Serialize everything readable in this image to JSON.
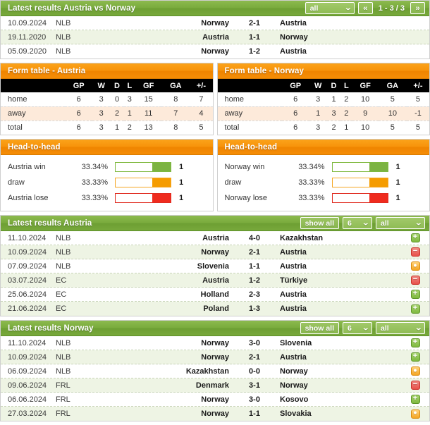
{
  "h2h_results_panel": {
    "title": "Latest results Austria vs Norway",
    "filter_select": "all",
    "pagination": {
      "prev": "«",
      "label": "1 - 3 / 3",
      "next": "»"
    },
    "rows": [
      {
        "date": "10.09.2024",
        "competition": "NLB",
        "home": "Norway",
        "score": "2-1",
        "away": "Austria"
      },
      {
        "date": "19.11.2020",
        "competition": "NLB",
        "home": "Austria",
        "score": "1-1",
        "away": "Norway"
      },
      {
        "date": "05.09.2020",
        "competition": "NLB",
        "home": "Norway",
        "score": "1-2",
        "away": "Austria"
      }
    ]
  },
  "form_table_austria": {
    "title": "Form table - Austria",
    "columns": [
      "",
      "GP",
      "W",
      "D",
      "L",
      "GF",
      "GA",
      "+/-"
    ],
    "rows": [
      {
        "label": "home",
        "gp": "6",
        "w": "3",
        "d": "0",
        "l": "3",
        "gf": "15",
        "ga": "8",
        "diff": "7"
      },
      {
        "label": "away",
        "gp": "6",
        "w": "3",
        "d": "2",
        "l": "1",
        "gf": "11",
        "ga": "7",
        "diff": "4"
      },
      {
        "label": "total",
        "gp": "6",
        "w": "3",
        "d": "1",
        "l": "2",
        "gf": "13",
        "ga": "8",
        "diff": "5"
      }
    ]
  },
  "form_table_norway": {
    "title": "Form table - Norway",
    "columns": [
      "",
      "GP",
      "W",
      "D",
      "L",
      "GF",
      "GA",
      "+/-"
    ],
    "rows": [
      {
        "label": "home",
        "gp": "6",
        "w": "3",
        "d": "1",
        "l": "2",
        "gf": "10",
        "ga": "5",
        "diff": "5"
      },
      {
        "label": "away",
        "gp": "6",
        "w": "1",
        "d": "3",
        "l": "2",
        "gf": "9",
        "ga": "10",
        "diff": "-1"
      },
      {
        "label": "total",
        "gp": "6",
        "w": "3",
        "d": "2",
        "l": "1",
        "gf": "10",
        "ga": "5",
        "diff": "5"
      }
    ]
  },
  "h2h_austria": {
    "title": "Head-to-head",
    "rows": [
      {
        "label": "Austria win",
        "percent": "33.34%",
        "count": "1",
        "color": "green"
      },
      {
        "label": "draw",
        "percent": "33.33%",
        "count": "1",
        "color": "orange"
      },
      {
        "label": "Austria lose",
        "percent": "33.33%",
        "count": "1",
        "color": "red"
      }
    ]
  },
  "h2h_norway": {
    "title": "Head-to-head",
    "rows": [
      {
        "label": "Norway win",
        "percent": "33.34%",
        "count": "1",
        "color": "green"
      },
      {
        "label": "draw",
        "percent": "33.33%",
        "count": "1",
        "color": "orange"
      },
      {
        "label": "Norway lose",
        "percent": "33.33%",
        "count": "1",
        "color": "red"
      }
    ]
  },
  "latest_austria": {
    "title": "Latest results Austria",
    "show_all_label": "show all",
    "count_select": "6",
    "filter_select": "all",
    "rows": [
      {
        "date": "11.10.2024",
        "competition": "NLB",
        "home": "Austria",
        "score": "4-0",
        "away": "Kazakhstan",
        "result": "win"
      },
      {
        "date": "10.09.2024",
        "competition": "NLB",
        "home": "Norway",
        "score": "2-1",
        "away": "Austria",
        "result": "loss"
      },
      {
        "date": "07.09.2024",
        "competition": "NLB",
        "home": "Slovenia",
        "score": "1-1",
        "away": "Austria",
        "result": "draw"
      },
      {
        "date": "03.07.2024",
        "competition": "EC",
        "home": "Austria",
        "score": "1-2",
        "away": "Türkiye",
        "result": "loss"
      },
      {
        "date": "25.06.2024",
        "competition": "EC",
        "home": "Holland",
        "score": "2-3",
        "away": "Austria",
        "result": "win"
      },
      {
        "date": "21.06.2024",
        "competition": "EC",
        "home": "Poland",
        "score": "1-3",
        "away": "Austria",
        "result": "win"
      }
    ]
  },
  "latest_norway": {
    "title": "Latest results Norway",
    "show_all_label": "show all",
    "count_select": "6",
    "filter_select": "all",
    "rows": [
      {
        "date": "11.10.2024",
        "competition": "NLB",
        "home": "Norway",
        "score": "3-0",
        "away": "Slovenia",
        "result": "win"
      },
      {
        "date": "10.09.2024",
        "competition": "NLB",
        "home": "Norway",
        "score": "2-1",
        "away": "Austria",
        "result": "win"
      },
      {
        "date": "06.09.2024",
        "competition": "NLB",
        "home": "Kazakhstan",
        "score": "0-0",
        "away": "Norway",
        "result": "draw"
      },
      {
        "date": "09.06.2024",
        "competition": "FRL",
        "home": "Denmark",
        "score": "3-1",
        "away": "Norway",
        "result": "loss"
      },
      {
        "date": "06.06.2024",
        "competition": "FRL",
        "home": "Norway",
        "score": "3-0",
        "away": "Kosovo",
        "result": "win"
      },
      {
        "date": "27.03.2024",
        "competition": "FRL",
        "home": "Norway",
        "score": "1-1",
        "away": "Slovakia",
        "result": "draw"
      }
    ]
  },
  "icons": {
    "chevron_down": "⌄",
    "plus": "+",
    "minus": "−",
    "dot": "•"
  },
  "colors": {
    "green": "#7cb342",
    "orange": "#f59c00",
    "red": "#ef2b1e",
    "header_green": "#77a83b",
    "header_orange": "#f58d06"
  }
}
